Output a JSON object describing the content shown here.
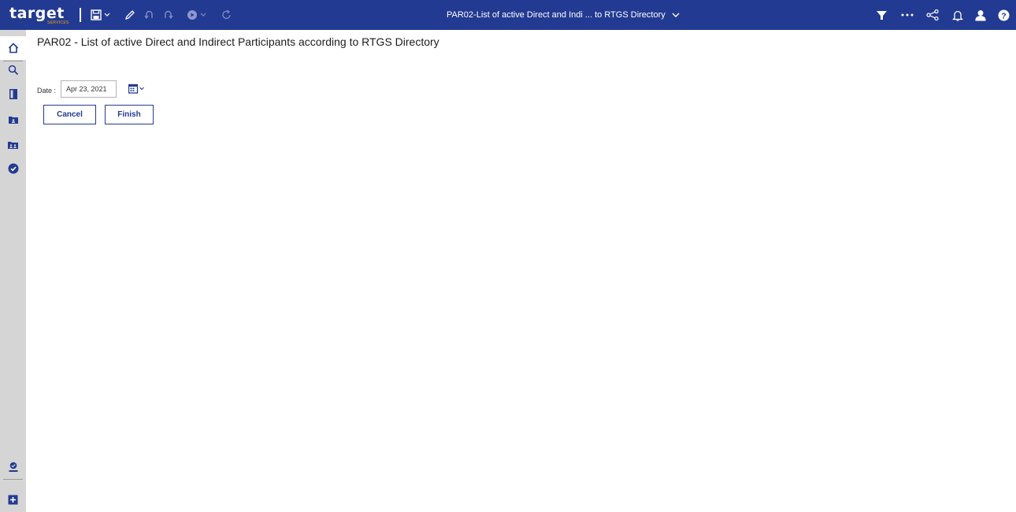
{
  "app": {
    "logo_text": "target",
    "logo_subtext": "SERVICES",
    "window_title": "PAR02-List of active Direct and Indi ... to RTGS Directory"
  },
  "toolbar_left": [
    "save-icon",
    "chevron-down-icon",
    "edit-pencil-icon",
    "undo-icon",
    "redo-icon",
    "run-icon",
    "chevron-down-icon",
    "refresh-icon"
  ],
  "toolbar_right": [
    "filter-icon",
    "more-options-icon",
    "share-icon",
    "notification-bell-icon",
    "user-icon",
    "help-icon"
  ],
  "sidebar": {
    "items": [
      "home-icon",
      "search-icon",
      "content-icon",
      "team-content-icon",
      "my-content-icon",
      "check-circle-icon"
    ],
    "bottom_items": [
      "account-icon",
      "new-icon"
    ]
  },
  "main": {
    "title": "PAR02 - List of active Direct and Indirect Participants according to RTGS Directory",
    "date_label": "Date :",
    "date_value": "Apr 23, 2021",
    "cancel_label": "Cancel",
    "finish_label": "Finish"
  },
  "colors": {
    "topbar": "#233a92",
    "sidebar": "#d5d5d5",
    "accent": "#233a92",
    "logo_sub": "#f0a500"
  }
}
